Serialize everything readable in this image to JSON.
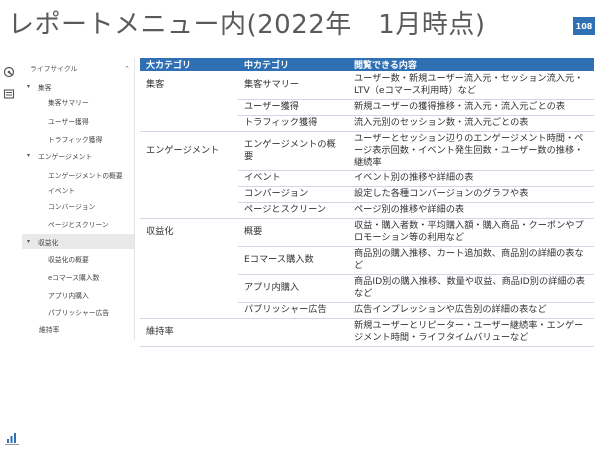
{
  "page": {
    "title": "レポートメニュー内(2022年　1月時点)",
    "page_number": "108"
  },
  "rail": {
    "icons": [
      "analytics-icon",
      "list-icon"
    ]
  },
  "sidebar": {
    "section": "ライフサイクル",
    "items": [
      {
        "label": "集客",
        "level": 1,
        "expanded": true
      },
      {
        "label": "集客サマリー",
        "level": 2
      },
      {
        "label": "ユーザー獲得",
        "level": 2
      },
      {
        "label": "トラフィック獲得",
        "level": 2
      },
      {
        "label": "エンゲージメント",
        "level": 1,
        "expanded": true
      },
      {
        "label": "エンゲージメントの概要",
        "level": 2
      },
      {
        "label": "イベント",
        "level": 2
      },
      {
        "label": "コンバージョン",
        "level": 2
      },
      {
        "label": "ページとスクリーン",
        "level": 2
      },
      {
        "label": "収益化",
        "level": 1,
        "expanded": true,
        "active": true
      },
      {
        "label": "収益化の概要",
        "level": 2
      },
      {
        "label": "eコマース購入数",
        "level": 2
      },
      {
        "label": "アプリ内購入",
        "level": 2
      },
      {
        "label": "パブリッシャー広告",
        "level": 2
      },
      {
        "label": "維持率",
        "level": 0
      }
    ]
  },
  "table": {
    "headers": [
      "大カテゴリ",
      "中カテゴリ",
      "閲覧できる内容"
    ],
    "rows": [
      {
        "cat": "集客",
        "sub": "集客サマリー",
        "desc": "ユーザー数・新規ユーザー流入元・セッション流入元・LTV（eコマース利用時）など"
      },
      {
        "cat": "",
        "sub": "ユーザー獲得",
        "desc": "新規ユーザーの獲得推移・流入元・流入元ごとの表"
      },
      {
        "cat": "",
        "sub": "トラフィック獲得",
        "desc": "流入元別のセッション数・流入元ごとの表"
      },
      {
        "cat": "エンゲージメント",
        "sub": "エンゲージメントの概要",
        "desc": "ユーザーとセッション辺りのエンゲージメント時間・ページ表示回数・イベント発生回数・ユーザー数の推移・継続率"
      },
      {
        "cat": "",
        "sub": "イベント",
        "desc": "イベント別の推移や詳細の表"
      },
      {
        "cat": "",
        "sub": "コンバージョン",
        "desc": "設定した各種コンバージョンのグラフや表"
      },
      {
        "cat": "",
        "sub": "ページとスクリーン",
        "desc": "ページ別の推移や詳細の表"
      },
      {
        "cat": "収益化",
        "sub": "概要",
        "desc": "収益・購入者数・平均購入額・購入商品・クーポンやプロモーション等の利用など"
      },
      {
        "cat": "",
        "sub": "Eコマース購入数",
        "desc": "商品別の購入推移、カート追加数、商品別の詳細の表など"
      },
      {
        "cat": "",
        "sub": "アプリ内購入",
        "desc": "商品ID別の購入推移、数量や収益、商品ID別の詳細の表など"
      },
      {
        "cat": "",
        "sub": "パブリッシャー広告",
        "desc": "広告インプレッションや広告別の詳細の表など"
      },
      {
        "cat": "維持率",
        "sub": "",
        "desc": "新規ユーザーとリピーター・ユーザー継続率・エンゲージメント時間・ライフタイムバリューなど"
      }
    ]
  },
  "colors": {
    "header_blue": "#2f6fb3",
    "row_line": "#cfd8e3",
    "active_bg": "#e9e9e9"
  }
}
